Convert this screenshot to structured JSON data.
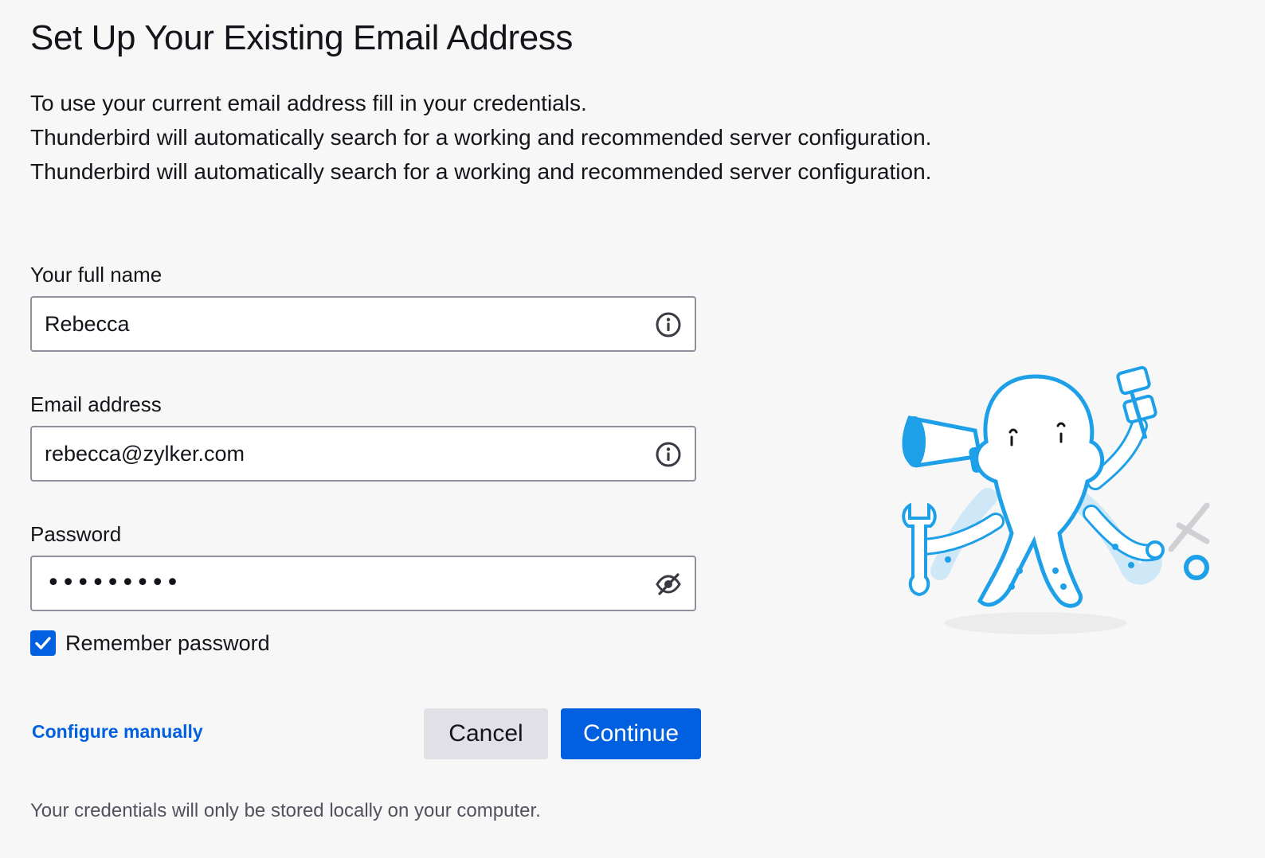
{
  "title": "Set Up Your Existing Email Address",
  "intro": [
    "To use your current email address fill in your credentials.",
    "Thunderbird will automatically search for a working and recommended server configuration.",
    "Thunderbird will automatically search for a working and recommended server configuration."
  ],
  "fields": {
    "full_name": {
      "label": "Your full name",
      "value": "Rebecca",
      "icon": "info-icon"
    },
    "email": {
      "label": "Email address",
      "value": "rebecca@zylker.com",
      "icon": "info-icon"
    },
    "password": {
      "label": "Password",
      "masked_value": "•••••••••",
      "icon": "eye-slash-icon"
    }
  },
  "remember_password": {
    "label": "Remember password",
    "checked": true
  },
  "configure_manually": "Configure manually",
  "buttons": {
    "cancel": "Cancel",
    "continue": "Continue"
  },
  "footnote": "Your credentials will only be stored locally on your computer.",
  "colors": {
    "accent": "#0060df",
    "mascot": "#1ea0e8"
  }
}
